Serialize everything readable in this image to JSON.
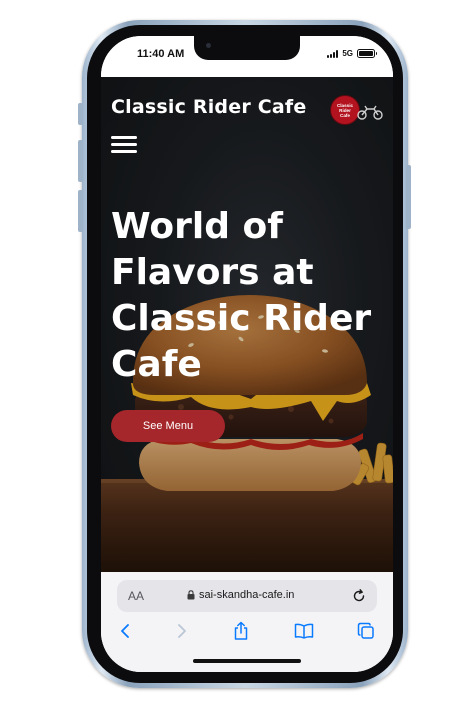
{
  "status_bar": {
    "time": "11:40 AM",
    "network": "5G",
    "icons": [
      "signal-icon",
      "battery-icon"
    ]
  },
  "header": {
    "brand": "Classic Rider Cafe",
    "logo_text": [
      "Classic",
      "Rider",
      "Cafe"
    ],
    "menu_icon": "hamburger-icon"
  },
  "hero": {
    "title": "World of Flavors at Classic Rider Cafe",
    "cta_label": "See Menu",
    "image": "burger-and-fries"
  },
  "browser": {
    "aa_label": "AA",
    "url": "sai-skandha-cafe.in",
    "toolbar_icons": [
      "back-icon",
      "forward-icon",
      "share-icon",
      "bookmarks-icon",
      "tabs-icon"
    ]
  },
  "colors": {
    "cta_background": "#a5262b",
    "logo_red": "#b3121f",
    "page_background": "#1c1f23",
    "ios_blue": "#0a7aff"
  }
}
